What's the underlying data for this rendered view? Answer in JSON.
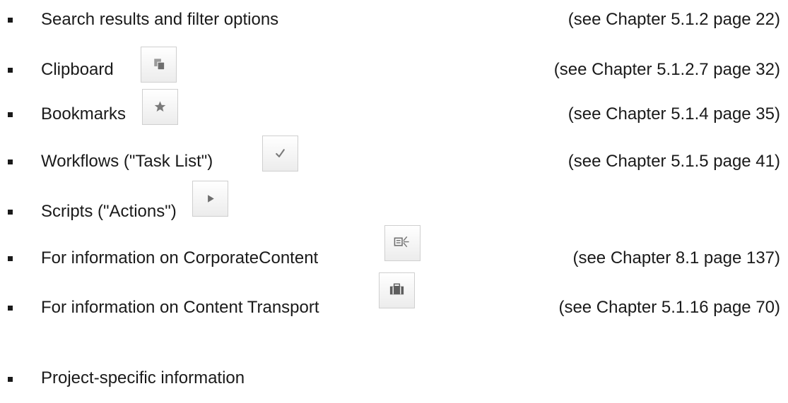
{
  "items": [
    {
      "label": "Search results and filter options",
      "reference": "(see Chapter 5.1.2 page 22)",
      "icon": null
    },
    {
      "label": "Clipboard",
      "reference": "(see Chapter 5.1.2.7 page 32)",
      "icon": "copy-icon"
    },
    {
      "label": "Bookmarks",
      "reference": "(see Chapter 5.1.4 page 35)",
      "icon": "star-icon"
    },
    {
      "label": "Workflows (\"Task List\")",
      "reference": "(see Chapter 5.1.5 page 41)",
      "icon": "checkmark-icon"
    },
    {
      "label": "Scripts (\"Actions\")",
      "reference": "",
      "icon": "play-icon"
    },
    {
      "label": "For information on CorporateContent",
      "reference": "(see Chapter 8.1 page 137)",
      "icon": "corporate-content-icon"
    },
    {
      "label": "For information on Content Transport",
      "reference": "(see Chapter 5.1.16 page 70)",
      "icon": "briefcase-icon"
    },
    {
      "label": "Project-specific information",
      "reference": "",
      "icon": null
    }
  ]
}
